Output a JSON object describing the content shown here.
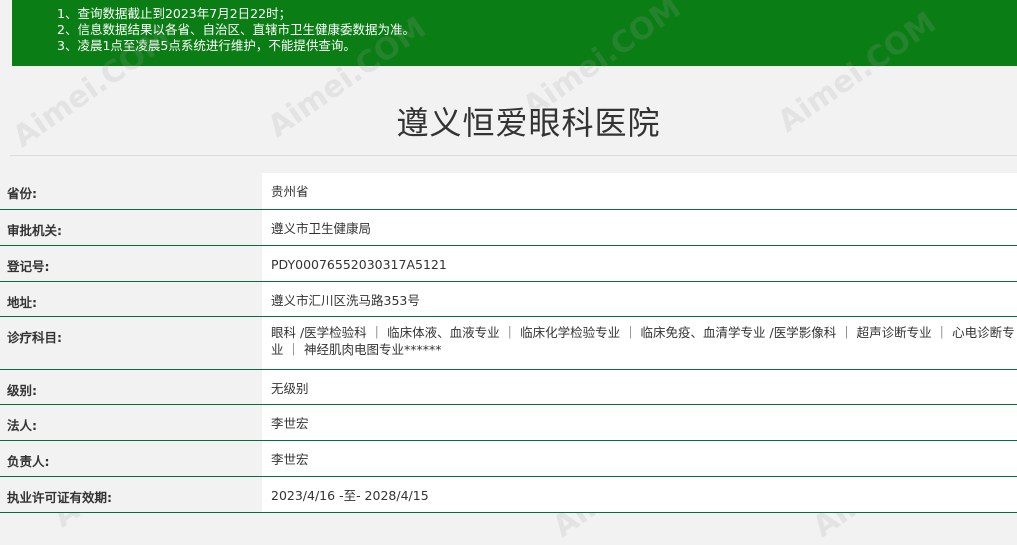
{
  "notice": {
    "lines": [
      "1、查询数据截止到2023年7月2日22时；",
      "2、信息数据结果以各省、自治区、直辖市卫生健康委数据为准。",
      "3、凌晨1点至凌晨5点系统进行维护，不能提供查询。"
    ]
  },
  "title": "遵义恒爱眼科医院",
  "rows": [
    {
      "label": "省份:",
      "value": "贵州省"
    },
    {
      "label": "审批机关:",
      "value": "遵义市卫生健康局"
    },
    {
      "label": "登记号:",
      "value": "PDY00076552030317A5121"
    },
    {
      "label": "地址:",
      "value": "遵义市汇川区洗马路353号"
    },
    {
      "label": "诊疗科目:",
      "value": "眼科 /医学检验科 ｜ 临床体液、血液专业 ｜ 临床化学检验专业 ｜ 临床免疫、血清学专业 /医学影像科 ｜ 超声诊断专业 ｜ 心电诊断专业 ｜ 神经肌肉电图专业******"
    },
    {
      "label": "级别:",
      "value": "无级别"
    },
    {
      "label": "法人:",
      "value": "李世宏"
    },
    {
      "label": "负责人:",
      "value": "李世宏"
    },
    {
      "label": "执业许可证有效期:",
      "value": "2023/4/16 -至- 2028/4/15"
    }
  ],
  "watermark_text": "Aimei.COM",
  "colors": {
    "accent": "#0a7d14",
    "rule": "#0a6c3b"
  }
}
